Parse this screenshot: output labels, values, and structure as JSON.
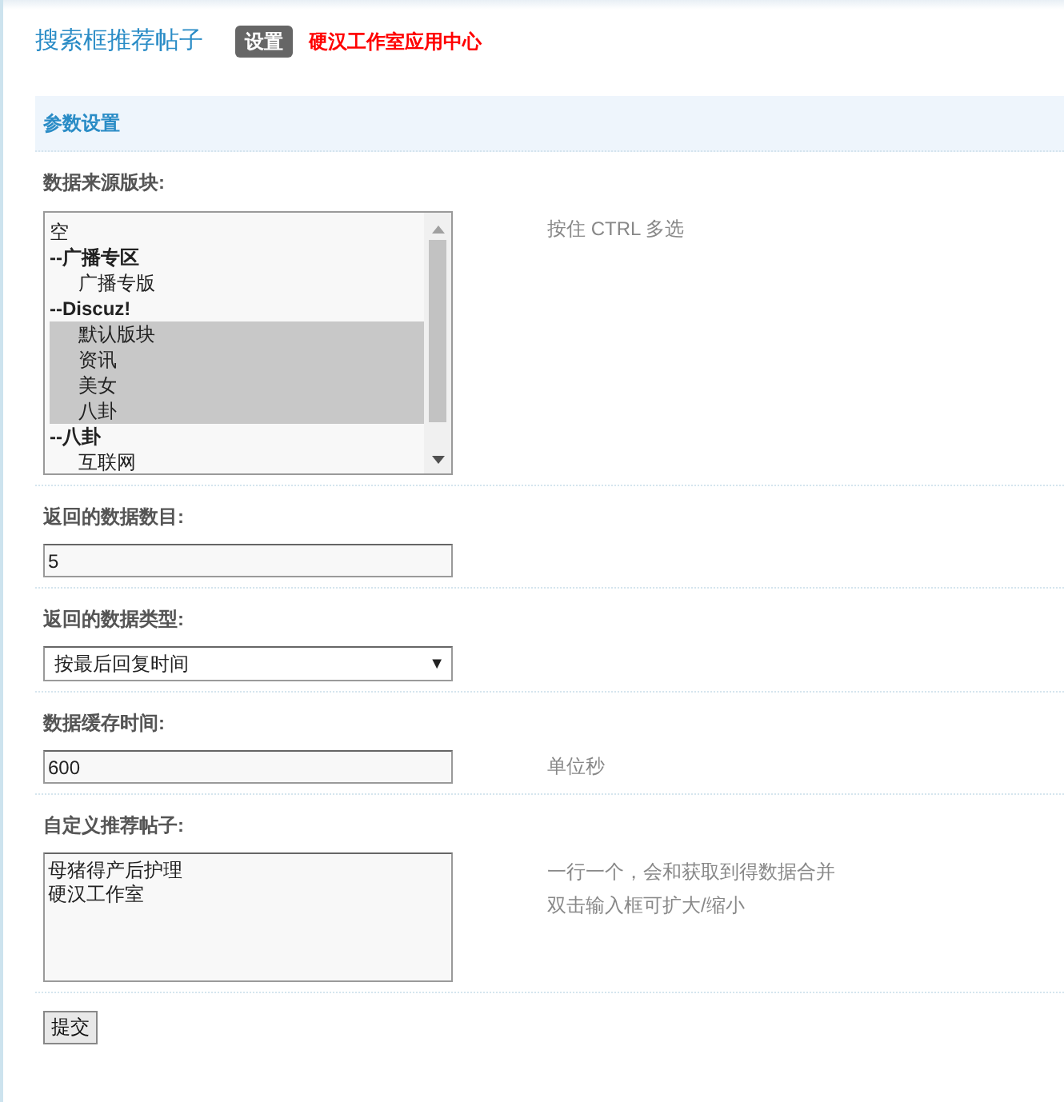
{
  "header": {
    "title": "搜索框推荐帖子",
    "badge": "设置",
    "link": "硬汉工作室应用中心"
  },
  "section": {
    "title": "参数设置"
  },
  "fields": [
    {
      "kind": "listbox",
      "label": "数据来源版块:",
      "hint": "按住 CTRL 多选",
      "options": [
        {
          "text": "空",
          "kind": "item",
          "indent": false,
          "selected": false
        },
        {
          "text": "--广播专区",
          "kind": "group",
          "indent": false,
          "selected": false
        },
        {
          "text": "广播专版",
          "kind": "item",
          "indent": true,
          "selected": false
        },
        {
          "text": "--Discuz!",
          "kind": "group",
          "indent": false,
          "selected": false
        },
        {
          "text": "默认版块",
          "kind": "item",
          "indent": true,
          "selected": true
        },
        {
          "text": "资讯",
          "kind": "item",
          "indent": true,
          "selected": true
        },
        {
          "text": "美女",
          "kind": "item",
          "indent": true,
          "selected": true
        },
        {
          "text": "八卦",
          "kind": "item",
          "indent": true,
          "selected": true
        },
        {
          "text": "--八卦",
          "kind": "group",
          "indent": false,
          "selected": false
        },
        {
          "text": "互联网",
          "kind": "item",
          "indent": true,
          "selected": false
        }
      ]
    },
    {
      "kind": "input",
      "label": "返回的数据数目:",
      "value": "5"
    },
    {
      "kind": "select",
      "label": "返回的数据类型:",
      "value": "按最后回复时间",
      "caret": "▼"
    },
    {
      "kind": "input",
      "label": "数据缓存时间:",
      "value": "600",
      "hint": "单位秒"
    },
    {
      "kind": "textarea",
      "label": "自定义推荐帖子:",
      "lines": [
        "母猪得产后护理",
        "硬汉工作室"
      ],
      "hints": [
        "一行一个，会和获取到得数据合并",
        "双击输入框可扩大/缩小"
      ]
    }
  ],
  "submit": "提交"
}
